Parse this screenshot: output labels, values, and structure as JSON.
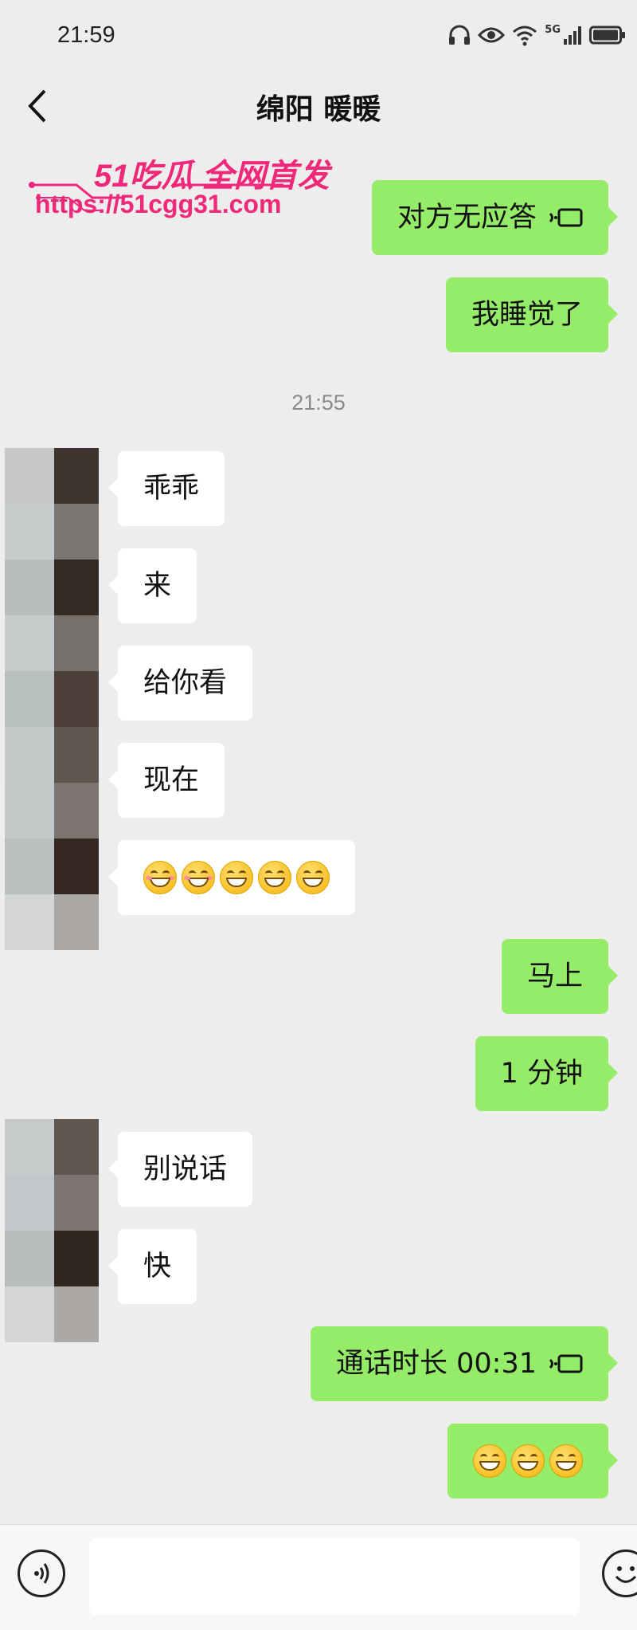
{
  "status_bar": {
    "time": "21:59",
    "network_label": "5G",
    "icons": [
      "headphones-icon",
      "eye-icon",
      "wifi-icon",
      "signal-icon",
      "battery-icon"
    ]
  },
  "header": {
    "title": "绵阳 暖暖",
    "back_icon": "chevron-left-icon"
  },
  "watermark": {
    "brand": "51吃瓜 全网首发",
    "url": "https://51cgg31.com"
  },
  "timestamp": "21:55",
  "messages": [
    {
      "side": "out",
      "text": "对方无应答",
      "icon": "call-icon"
    },
    {
      "side": "out",
      "text": "我睡觉了"
    },
    {
      "side": "in",
      "text": "乖乖"
    },
    {
      "side": "in",
      "text": "来"
    },
    {
      "side": "in",
      "text": "给你看"
    },
    {
      "side": "in",
      "text": "现在"
    },
    {
      "side": "in",
      "emojis": [
        "grin-blush",
        "grin-blush",
        "grin",
        "grin",
        "grin"
      ]
    },
    {
      "side": "out",
      "text": "马上"
    },
    {
      "side": "out",
      "text": "1 分钟"
    },
    {
      "side": "in",
      "text": "别说话"
    },
    {
      "side": "in",
      "text": "快"
    },
    {
      "side": "out",
      "text": "通话时长 00:31",
      "icon": "call-icon"
    },
    {
      "side": "out",
      "emojis": [
        "grin",
        "grin",
        "grin"
      ]
    }
  ],
  "colors": {
    "background": "#ededed",
    "outgoing_bubble": "#95ec69",
    "incoming_bubble": "#ffffff",
    "watermark": "#f0287a"
  },
  "input_bar": {
    "voice_icon": "voice-icon",
    "emoji_icon": "emoji-icon"
  }
}
